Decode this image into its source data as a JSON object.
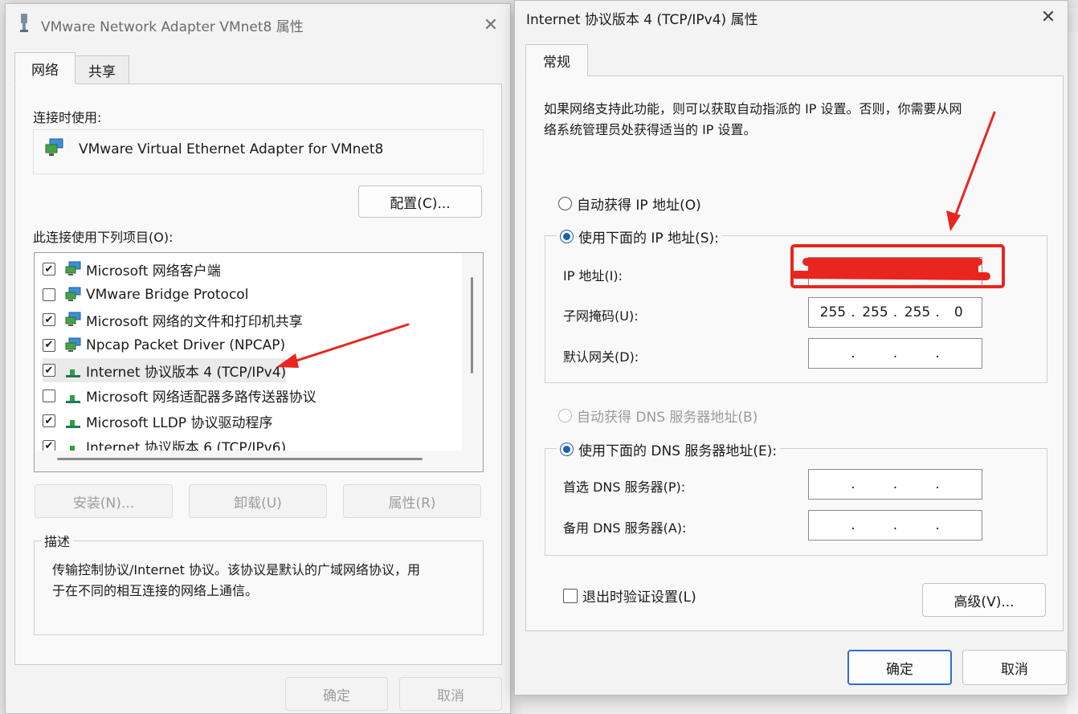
{
  "left_dialog": {
    "title": "VMware Network Adapter VMnet8 属性",
    "tabs": [
      {
        "label": "网络"
      },
      {
        "label": "共享"
      }
    ],
    "connect_using_label": "连接时使用:",
    "adapter_name": "VMware Virtual Ethernet Adapter for VMnet8",
    "configure_button": "配置(C)...",
    "items_label": "此连接使用下列项目(O):",
    "items": [
      {
        "label": "Microsoft 网络客户端",
        "checked": true,
        "icon": "network-client-icon"
      },
      {
        "label": "VMware Bridge Protocol",
        "checked": false,
        "icon": "network-client-icon"
      },
      {
        "label": "Microsoft 网络的文件和打印机共享",
        "checked": true,
        "icon": "network-client-icon"
      },
      {
        "label": "Npcap Packet Driver (NPCAP)",
        "checked": true,
        "icon": "network-client-icon"
      },
      {
        "label": "Internet 协议版本 4 (TCP/IPv4)",
        "checked": true,
        "icon": "protocol-icon",
        "selected": true
      },
      {
        "label": "Microsoft 网络适配器多路传送器协议",
        "checked": false,
        "icon": "protocol-icon"
      },
      {
        "label": "Microsoft LLDP 协议驱动程序",
        "checked": true,
        "icon": "protocol-icon"
      },
      {
        "label": "Internet 协议版本 6 (TCP/IPv6)",
        "checked": true,
        "icon": "protocol-icon"
      }
    ],
    "install_button": "安装(N)...",
    "uninstall_button": "卸载(U)",
    "properties_button": "属性(R)",
    "description_title": "描述",
    "description_text_line1": "传输控制协议/Internet 协议。该协议是默认的广域网络协议，用",
    "description_text_line2": "于在不同的相互连接的网络上通信。",
    "ok_button": "确定",
    "cancel_button": "取消"
  },
  "right_dialog": {
    "title": "Internet 协议版本 4 (TCP/IPv4) 属性",
    "tab_general": "常规",
    "intro_line1": "如果网络支持此功能，则可以获取自动指派的 IP 设置。否则，你需要从网",
    "intro_line2": "络系统管理员处获得适当的 IP 设置。",
    "auto_ip_label": "自动获得 IP 地址(O)",
    "manual_ip_label": "使用下面的 IP 地址(S):",
    "ip_address_label": "IP 地址(I):",
    "ip_address_value": "",
    "subnet_label": "子网掩码(U):",
    "subnet_value": [
      "255",
      "255",
      "255",
      "0"
    ],
    "gateway_label": "默认网关(D):",
    "auto_dns_label": "自动获得 DNS 服务器地址(B)",
    "manual_dns_label": "使用下面的 DNS 服务器地址(E):",
    "preferred_dns_label": "首选 DNS 服务器(P):",
    "alternate_dns_label": "备用 DNS 服务器(A):",
    "validate_label": "退出时验证设置(L)",
    "advanced_button": "高级(V)...",
    "ok_button": "确定",
    "cancel_button": "取消"
  },
  "colors": {
    "accent": "#1a5fb4",
    "annotation_red": "#e8261f"
  }
}
